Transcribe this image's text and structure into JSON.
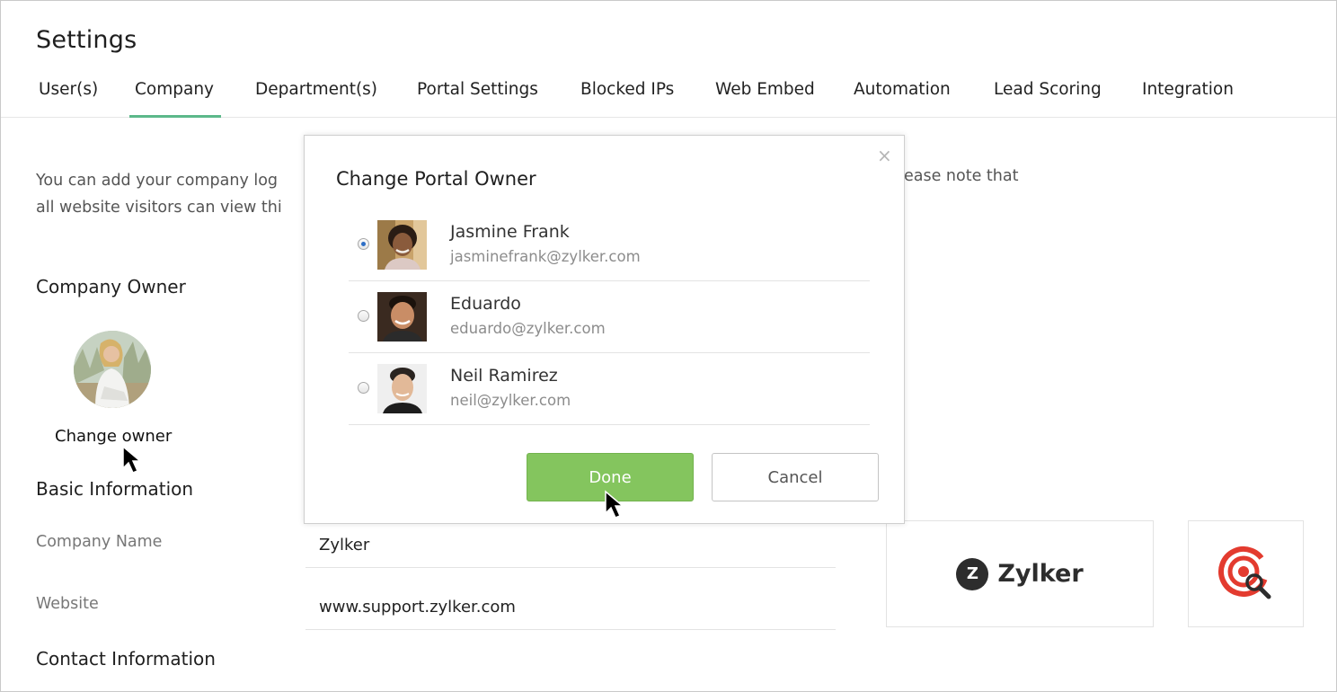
{
  "page": {
    "title": "Settings"
  },
  "tabs": [
    {
      "label": "User(s)",
      "active": false
    },
    {
      "label": "Company",
      "active": true
    },
    {
      "label": "Department(s)",
      "active": false
    },
    {
      "label": "Portal Settings",
      "active": false
    },
    {
      "label": "Blocked IPs",
      "active": false
    },
    {
      "label": "Web Embed",
      "active": false
    },
    {
      "label": "Automation",
      "active": false
    },
    {
      "label": "Lead Scoring",
      "active": false
    },
    {
      "label": "Integration",
      "active": false
    }
  ],
  "intro": {
    "line1": "You can add your company log",
    "line2": "all website visitors can view thi",
    "line1_tail": "ease note that"
  },
  "company_owner": {
    "heading": "Company Owner",
    "change_label": "Change owner"
  },
  "basic_information": {
    "heading": "Basic Information",
    "company_name_label": "Company Name",
    "company_name_value": "Zylker",
    "website_label": "Website",
    "website_value": "www.support.zylker.com"
  },
  "contact_information": {
    "heading": "Contact Information"
  },
  "logos": {
    "brand_text": "Zylker",
    "brand_letter": "Z"
  },
  "modal": {
    "title": "Change Portal Owner",
    "close_glyph": "×",
    "owners": [
      {
        "name": "Jasmine Frank",
        "email": "jasminefrank@zylker.com",
        "selected": true
      },
      {
        "name": "Eduardo",
        "email": "eduardo@zylker.com",
        "selected": false
      },
      {
        "name": "Neil Ramirez",
        "email": "neil@zylker.com",
        "selected": false
      }
    ],
    "done_label": "Done",
    "cancel_label": "Cancel"
  },
  "colors": {
    "accent": "#5cb88a",
    "done_button": "#84c55e",
    "radio_selected": "#2f6fc6",
    "logo_red": "#e33b2f"
  },
  "icons": {
    "close": "close-icon",
    "cursor": "mouse-pointer-icon",
    "favicon": "target-search-icon"
  }
}
